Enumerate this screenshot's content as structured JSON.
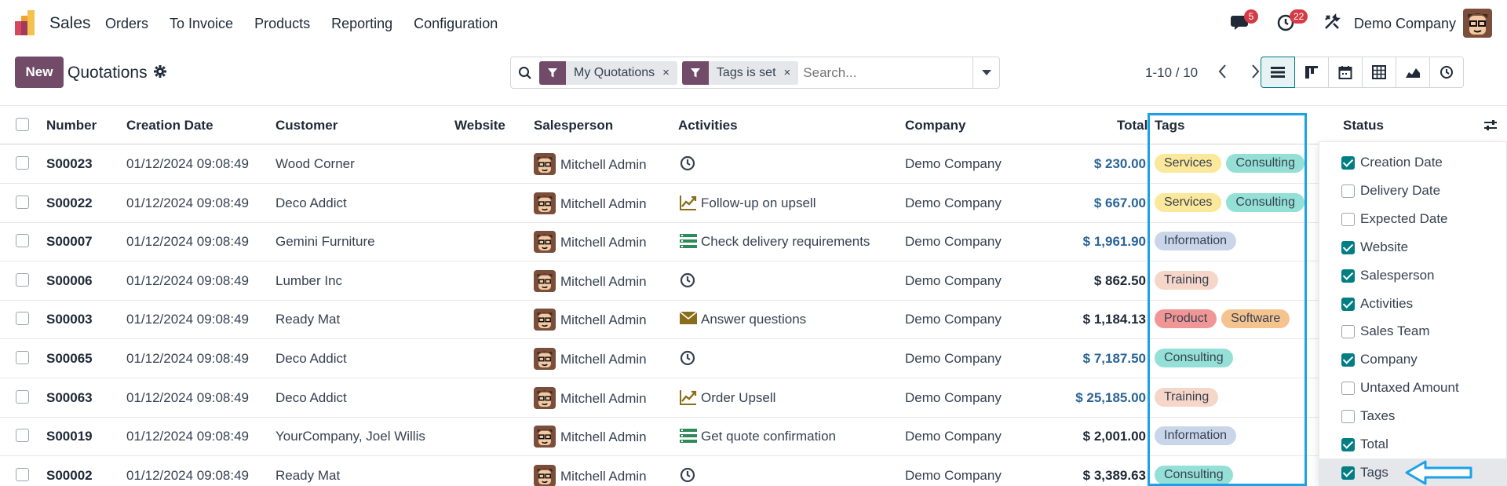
{
  "navbar": {
    "app_name": "Sales",
    "menu": [
      "Orders",
      "To Invoice",
      "Products",
      "Reporting",
      "Configuration"
    ],
    "chat_badge": "5",
    "activity_badge": "22",
    "company": "Demo Company"
  },
  "control": {
    "new_label": "New",
    "title": "Quotations",
    "facets": [
      {
        "label": "My Quotations",
        "remove": "×"
      },
      {
        "label": "Tags is set",
        "remove": "×"
      }
    ],
    "search_placeholder": "Search...",
    "pager": "1-10 / 10"
  },
  "columns": {
    "number": "Number",
    "creation_date": "Creation Date",
    "customer": "Customer",
    "website": "Website",
    "salesperson": "Salesperson",
    "activities": "Activities",
    "company": "Company",
    "total": "Total",
    "tags": "Tags",
    "status": "Status"
  },
  "rows": [
    {
      "number": "S00023",
      "date": "01/12/2024 09:08:49",
      "customer": "Wood Corner",
      "salesperson": "Mitchell Admin",
      "activity_icon": "clock-icon",
      "activity": "",
      "company": "Demo Company",
      "total": "$ 230.00",
      "total_blue": true,
      "tags": [
        {
          "label": "Services",
          "color": "#fbe89a"
        },
        {
          "label": "Consulting",
          "color": "#95e0d6"
        }
      ]
    },
    {
      "number": "S00022",
      "date": "01/12/2024 09:08:49",
      "customer": "Deco Addict",
      "salesperson": "Mitchell Admin",
      "activity_icon": "upsell-chart-icon",
      "activity": "Follow-up on upsell",
      "company": "Demo Company",
      "total": "$ 667.00",
      "total_blue": true,
      "tags": [
        {
          "label": "Services",
          "color": "#fbe89a"
        },
        {
          "label": "Consulting",
          "color": "#95e0d6"
        }
      ]
    },
    {
      "number": "S00007",
      "date": "01/12/2024 09:08:49",
      "customer": "Gemini Furniture",
      "salesperson": "Mitchell Admin",
      "activity_icon": "todo-list-icon",
      "activity": "Check delivery requirements",
      "company": "Demo Company",
      "total": "$ 1,961.90",
      "total_blue": true,
      "tags": [
        {
          "label": "Information",
          "color": "#c9d6ea"
        }
      ]
    },
    {
      "number": "S00006",
      "date": "01/12/2024 09:08:49",
      "customer": "Lumber Inc",
      "salesperson": "Mitchell Admin",
      "activity_icon": "clock-icon",
      "activity": "",
      "company": "Demo Company",
      "total": "$ 862.50",
      "total_blue": false,
      "tags": [
        {
          "label": "Training",
          "color": "#f6d6c8"
        }
      ]
    },
    {
      "number": "S00003",
      "date": "01/12/2024 09:08:49",
      "customer": "Ready Mat",
      "salesperson": "Mitchell Admin",
      "activity_icon": "envelope-icon",
      "activity": "Answer questions",
      "company": "Demo Company",
      "total": "$ 1,184.13",
      "total_blue": false,
      "tags": [
        {
          "label": "Product",
          "color": "#f19696"
        },
        {
          "label": "Software",
          "color": "#f4c38f"
        }
      ]
    },
    {
      "number": "S00065",
      "date": "01/12/2024 09:08:49",
      "customer": "Deco Addict",
      "salesperson": "Mitchell Admin",
      "activity_icon": "clock-icon",
      "activity": "",
      "company": "Demo Company",
      "total": "$ 7,187.50",
      "total_blue": true,
      "tags": [
        {
          "label": "Consulting",
          "color": "#95e0d6"
        }
      ]
    },
    {
      "number": "S00063",
      "date": "01/12/2024 09:08:49",
      "customer": "Deco Addict",
      "salesperson": "Mitchell Admin",
      "activity_icon": "upsell-chart-icon",
      "activity": "Order Upsell",
      "company": "Demo Company",
      "total": "$ 25,185.00",
      "total_blue": true,
      "tags": [
        {
          "label": "Training",
          "color": "#f6d6c8"
        }
      ]
    },
    {
      "number": "S00019",
      "date": "01/12/2024 09:08:49",
      "customer": "YourCompany, Joel Willis",
      "salesperson": "Mitchell Admin",
      "activity_icon": "todo-list-icon",
      "activity": "Get quote confirmation",
      "company": "Demo Company",
      "total": "$ 2,001.00",
      "total_blue": false,
      "tags": [
        {
          "label": "Information",
          "color": "#c9d6ea"
        }
      ]
    },
    {
      "number": "S00002",
      "date": "01/12/2024 09:08:49",
      "customer": "Ready Mat",
      "salesperson": "Mitchell Admin",
      "activity_icon": "clock-icon",
      "activity": "",
      "company": "Demo Company",
      "total": "$ 3,389.63",
      "total_blue": false,
      "tags": [
        {
          "label": "Consulting",
          "color": "#95e0d6"
        }
      ]
    }
  ],
  "optional_columns": [
    {
      "label": "Creation Date",
      "checked": true
    },
    {
      "label": "Delivery Date",
      "checked": false
    },
    {
      "label": "Expected Date",
      "checked": false
    },
    {
      "label": "Website",
      "checked": true
    },
    {
      "label": "Salesperson",
      "checked": true
    },
    {
      "label": "Activities",
      "checked": true
    },
    {
      "label": "Sales Team",
      "checked": false
    },
    {
      "label": "Company",
      "checked": true
    },
    {
      "label": "Untaxed Amount",
      "checked": false
    },
    {
      "label": "Taxes",
      "checked": false
    },
    {
      "label": "Total",
      "checked": true
    },
    {
      "label": "Tags",
      "checked": true
    }
  ],
  "colors": {
    "brand": "#714b67",
    "accent": "#017e84",
    "highlight": "#1aa1e6",
    "link_blue": "#2a6496"
  }
}
